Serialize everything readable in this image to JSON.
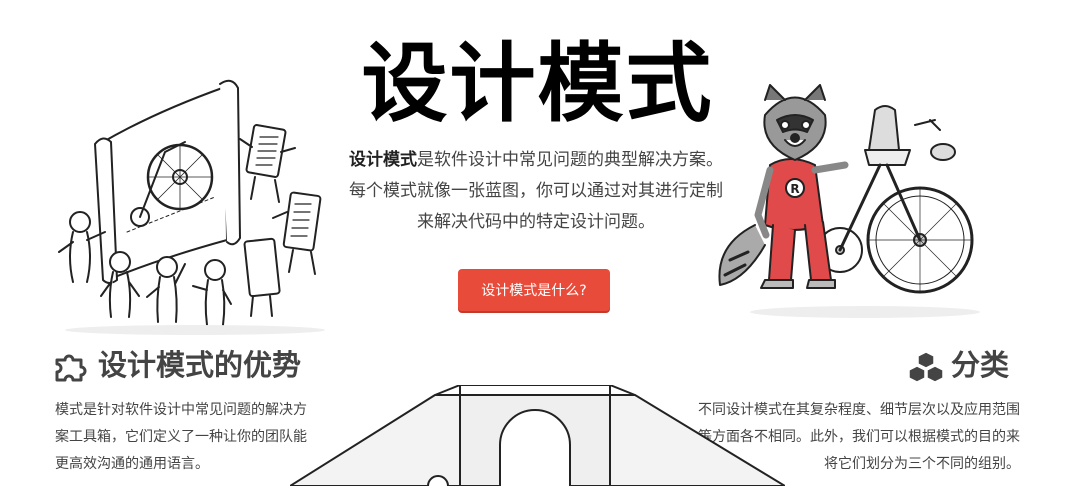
{
  "hero": {
    "title": "设计模式",
    "desc_strong": "设计模式",
    "desc_rest": "是软件设计中常见问题的典型解决方案。每个模式就像一张蓝图，你可以通过对其进行定制来解决代码中的特定设计问题。",
    "cta_label": "设计模式是什么?"
  },
  "benefits": {
    "title": "设计模式的优势",
    "text": "模式是针对软件设计中常见问题的解决方案工具箱，它们定义了一种让你的团队能更高效沟通的通用语言。",
    "icon": "puzzle-icon"
  },
  "classification": {
    "title": "分类",
    "text": "不同设计模式在其复杂程度、细节层次以及应用范围等方面各不相同。此外，我们可以根据模式的目的来将它们划分为三个不同的组别。",
    "icon": "cubes-icon"
  },
  "illustration_text": {
    "raccoon_badge": "R"
  },
  "colors": {
    "accent": "#e84b3a",
    "heading": "#444444",
    "title": "#000000"
  }
}
